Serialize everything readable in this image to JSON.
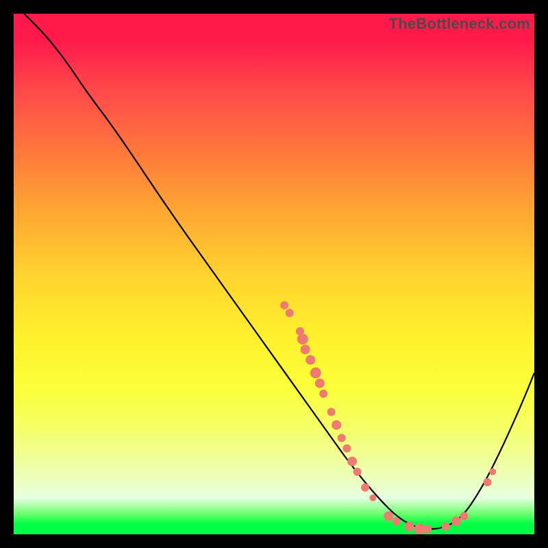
{
  "watermark": "TheBottleneck.com",
  "chart_data": {
    "type": "line",
    "title": "",
    "xlabel": "",
    "ylabel": "",
    "xlim": [
      0,
      100
    ],
    "ylim": [
      0,
      100
    ],
    "curve": [
      {
        "x": 2,
        "y": 100
      },
      {
        "x": 6,
        "y": 96
      },
      {
        "x": 10,
        "y": 91
      },
      {
        "x": 14,
        "y": 85
      },
      {
        "x": 20,
        "y": 77
      },
      {
        "x": 30,
        "y": 62
      },
      {
        "x": 40,
        "y": 48
      },
      {
        "x": 50,
        "y": 34
      },
      {
        "x": 55,
        "y": 27
      },
      {
        "x": 60,
        "y": 20
      },
      {
        "x": 65,
        "y": 13
      },
      {
        "x": 70,
        "y": 7
      },
      {
        "x": 74,
        "y": 3
      },
      {
        "x": 78,
        "y": 1
      },
      {
        "x": 82,
        "y": 1
      },
      {
        "x": 86,
        "y": 3
      },
      {
        "x": 90,
        "y": 9
      },
      {
        "x": 94,
        "y": 17
      },
      {
        "x": 98,
        "y": 26
      },
      {
        "x": 100,
        "y": 31
      }
    ],
    "points": [
      {
        "x": 52,
        "y": 44,
        "r": 6
      },
      {
        "x": 53,
        "y": 42.5,
        "r": 6
      },
      {
        "x": 55,
        "y": 39,
        "r": 6
      },
      {
        "x": 55.5,
        "y": 37.5,
        "r": 8
      },
      {
        "x": 56,
        "y": 35.5,
        "r": 7
      },
      {
        "x": 57,
        "y": 33.5,
        "r": 7
      },
      {
        "x": 58,
        "y": 31,
        "r": 8
      },
      {
        "x": 58.8,
        "y": 29,
        "r": 7
      },
      {
        "x": 59.5,
        "y": 27,
        "r": 6
      },
      {
        "x": 61,
        "y": 23.5,
        "r": 6
      },
      {
        "x": 62,
        "y": 21,
        "r": 7
      },
      {
        "x": 63,
        "y": 18.5,
        "r": 6
      },
      {
        "x": 64,
        "y": 16.5,
        "r": 6
      },
      {
        "x": 65,
        "y": 14,
        "r": 7
      },
      {
        "x": 66,
        "y": 12,
        "r": 6
      },
      {
        "x": 67.5,
        "y": 9,
        "r": 6
      },
      {
        "x": 69,
        "y": 7,
        "r": 5
      },
      {
        "x": 72,
        "y": 3.5,
        "r": 7
      },
      {
        "x": 73.5,
        "y": 2.5,
        "r": 6
      },
      {
        "x": 76,
        "y": 1.5,
        "r": 7
      },
      {
        "x": 78,
        "y": 1,
        "r": 8
      },
      {
        "x": 79.5,
        "y": 1,
        "r": 6
      },
      {
        "x": 83,
        "y": 1.5,
        "r": 6
      },
      {
        "x": 85,
        "y": 2.5,
        "r": 7
      },
      {
        "x": 86.5,
        "y": 3.5,
        "r": 6
      },
      {
        "x": 91,
        "y": 10,
        "r": 6
      },
      {
        "x": 92,
        "y": 12,
        "r": 5
      }
    ],
    "colors": {
      "curve": "#000000",
      "points": "#ef7a6f",
      "gradient_top": "#ff1a4b",
      "gradient_bottom": "#00ff44"
    }
  }
}
